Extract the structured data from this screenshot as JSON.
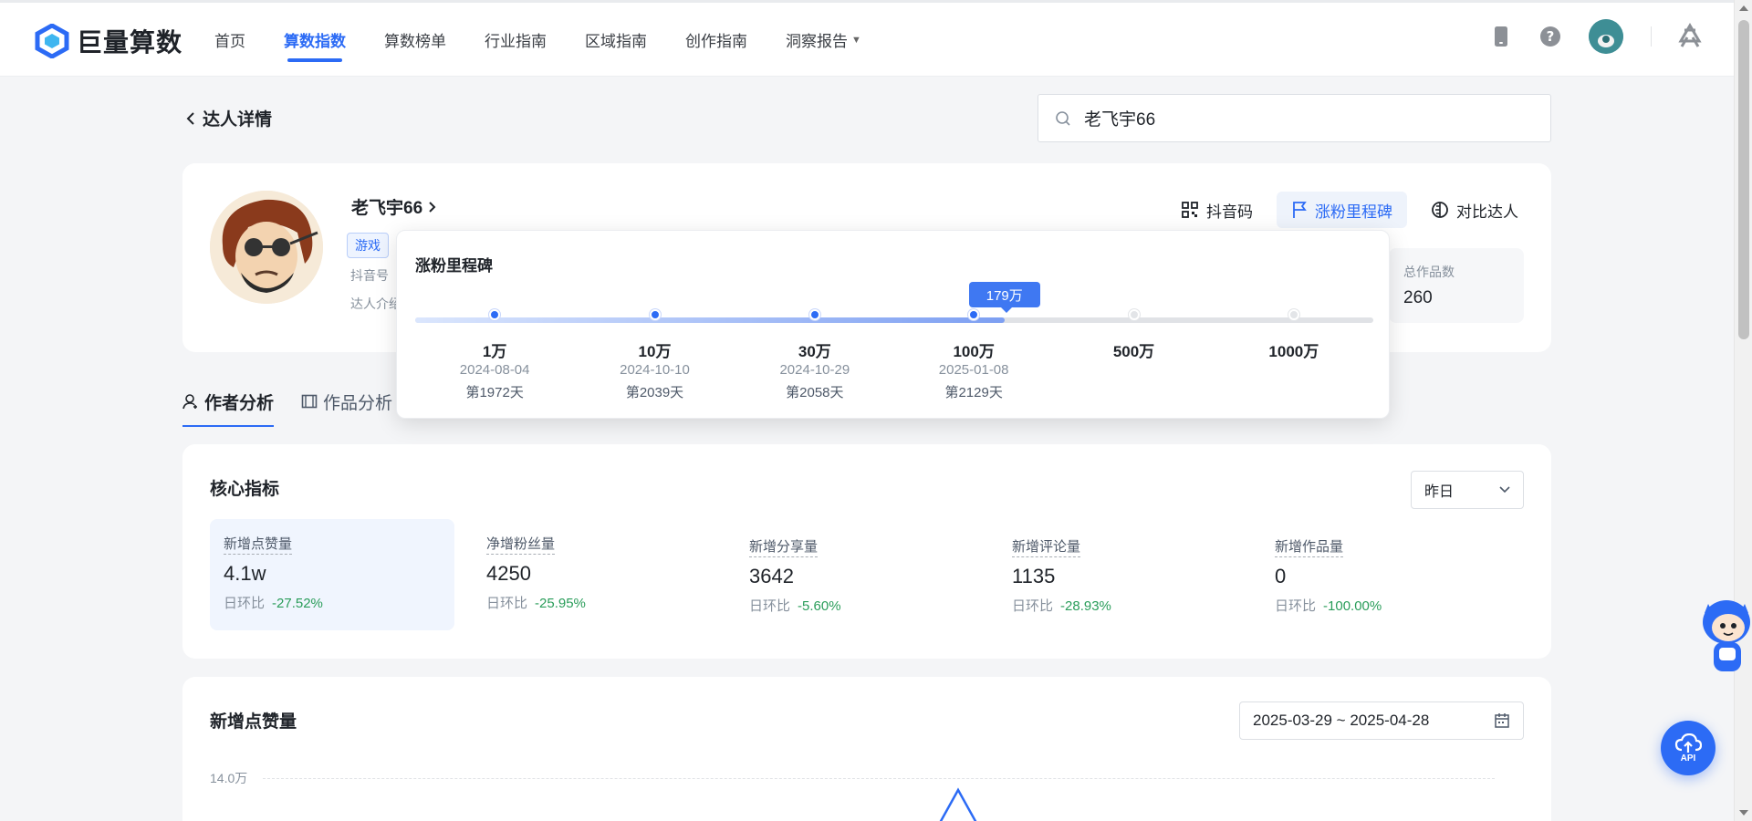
{
  "brand": {
    "name": "巨量算数"
  },
  "nav": {
    "items": [
      {
        "label": "首页",
        "active": false
      },
      {
        "label": "算数指数",
        "active": true
      },
      {
        "label": "算数榜单",
        "active": false
      },
      {
        "label": "行业指南",
        "active": false
      },
      {
        "label": "区域指南",
        "active": false
      },
      {
        "label": "创作指南",
        "active": false
      },
      {
        "label": "洞察报告",
        "active": false
      }
    ]
  },
  "breadcrumb": {
    "back_label": "达人详情"
  },
  "search": {
    "value": "老飞宇66",
    "placeholder": ""
  },
  "profile": {
    "name": "老飞宇66",
    "tag": "游戏",
    "douyin_id_label": "抖音号",
    "intro_label": "达人介绍",
    "actions": {
      "qrcode": "抖音码",
      "milestone": "涨粉里程碑",
      "compare": "对比达人"
    },
    "stat": {
      "label": "总作品数",
      "value": "260"
    }
  },
  "tabs": [
    {
      "label": "作者分析",
      "active": true
    },
    {
      "label": "作品分析",
      "active": false
    }
  ],
  "milestone": {
    "title": "涨粉里程碑",
    "current_label": "179万",
    "current_fraction": 0.615,
    "points": [
      {
        "label": "1万",
        "date": "2024-08-04",
        "day": "第1972天",
        "reached": true
      },
      {
        "label": "10万",
        "date": "2024-10-10",
        "day": "第2039天",
        "reached": true
      },
      {
        "label": "30万",
        "date": "2024-10-29",
        "day": "第2058天",
        "reached": true
      },
      {
        "label": "100万",
        "date": "2025-01-08",
        "day": "第2129天",
        "reached": true
      },
      {
        "label": "500万",
        "date": "",
        "day": "",
        "reached": false
      },
      {
        "label": "1000万",
        "date": "",
        "day": "",
        "reached": false
      }
    ]
  },
  "core": {
    "title": "核心指标",
    "period": "昨日",
    "compare_label": "日环比",
    "metrics": [
      {
        "name": "新增点赞量",
        "value": "4.1w",
        "change": "-27.52%"
      },
      {
        "name": "净增粉丝量",
        "value": "4250",
        "change": "-25.95%"
      },
      {
        "name": "新增分享量",
        "value": "3642",
        "change": "-5.60%"
      },
      {
        "name": "新增评论量",
        "value": "1135",
        "change": "-28.93%"
      },
      {
        "name": "新增作品量",
        "value": "0",
        "change": "-100.00%"
      }
    ]
  },
  "chart": {
    "title": "新增点赞量",
    "date_range": "2025-03-29 ~ 2025-04-28",
    "y_top_label": "14.0万"
  },
  "floating": {
    "api_label": "API"
  },
  "colors": {
    "accent": "#2c6bf5",
    "down": "#2a9d5a"
  }
}
